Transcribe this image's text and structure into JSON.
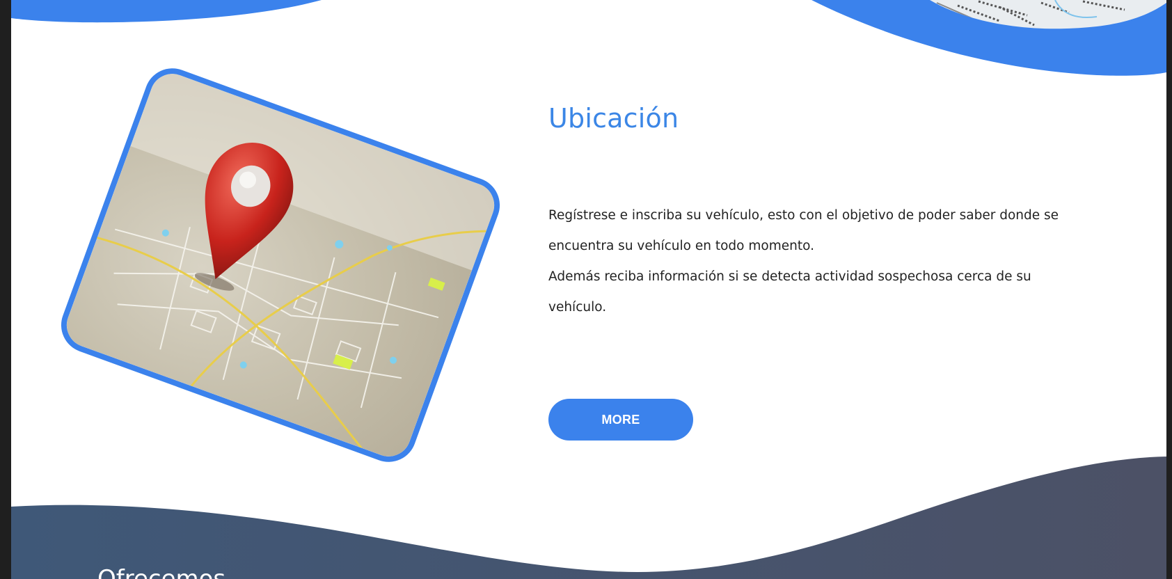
{
  "colors": {
    "accent": "#3b82ec",
    "title": "#3b86e6",
    "body_text": "#222222",
    "footer_gradient_start": "#3f5878",
    "footer_gradient_end": "#4c5166",
    "side_bar": "#1f1f1f"
  },
  "location_section": {
    "image_icon": "map-location-pin-image",
    "title": "Ubicación",
    "paragraph_1": "Regístrese e inscriba su vehículo, esto con el objetivo de poder saber donde se encuentra su vehículo en todo momento.",
    "paragraph_2": "Además reciba información si se detecta actividad sospechosa cerca de su vehículo.",
    "more_button": "MORE"
  },
  "next_section": {
    "title": "Ofrecemos"
  }
}
